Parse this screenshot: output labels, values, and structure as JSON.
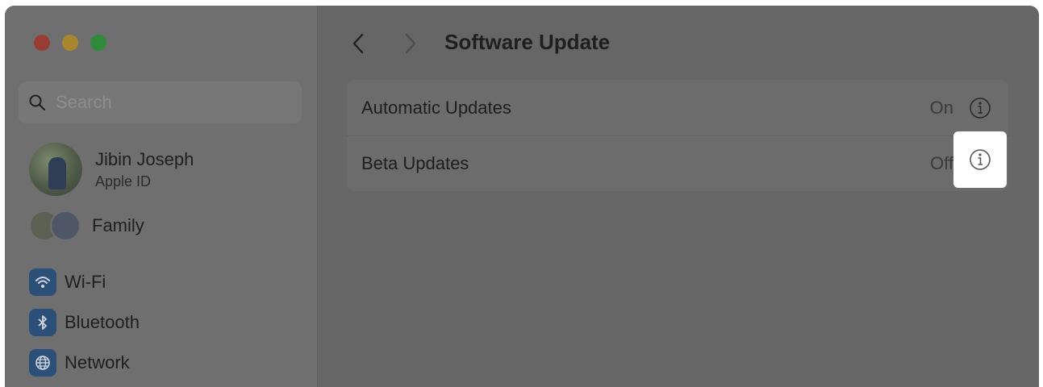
{
  "window": {
    "title": "Software Update"
  },
  "sidebar": {
    "search": {
      "placeholder": "Search"
    },
    "profile": {
      "name": "Jibin Joseph",
      "subtitle": "Apple ID"
    },
    "family_label": "Family",
    "items": [
      {
        "label": "Wi-Fi",
        "icon": "wifi-icon"
      },
      {
        "label": "Bluetooth",
        "icon": "bluetooth-icon"
      },
      {
        "label": "Network",
        "icon": "globe-icon"
      }
    ]
  },
  "main": {
    "title": "Software Update",
    "settings": [
      {
        "label": "Automatic Updates",
        "value": "On",
        "icon": "info-icon"
      },
      {
        "label": "Beta Updates",
        "value": "Off",
        "icon": "info-icon"
      }
    ]
  },
  "colors": {
    "close": "#ff5f57",
    "minimize": "#febc2e",
    "maximize": "#28c840",
    "dim_overlay": "#666666",
    "highlight": "#ffffff"
  }
}
